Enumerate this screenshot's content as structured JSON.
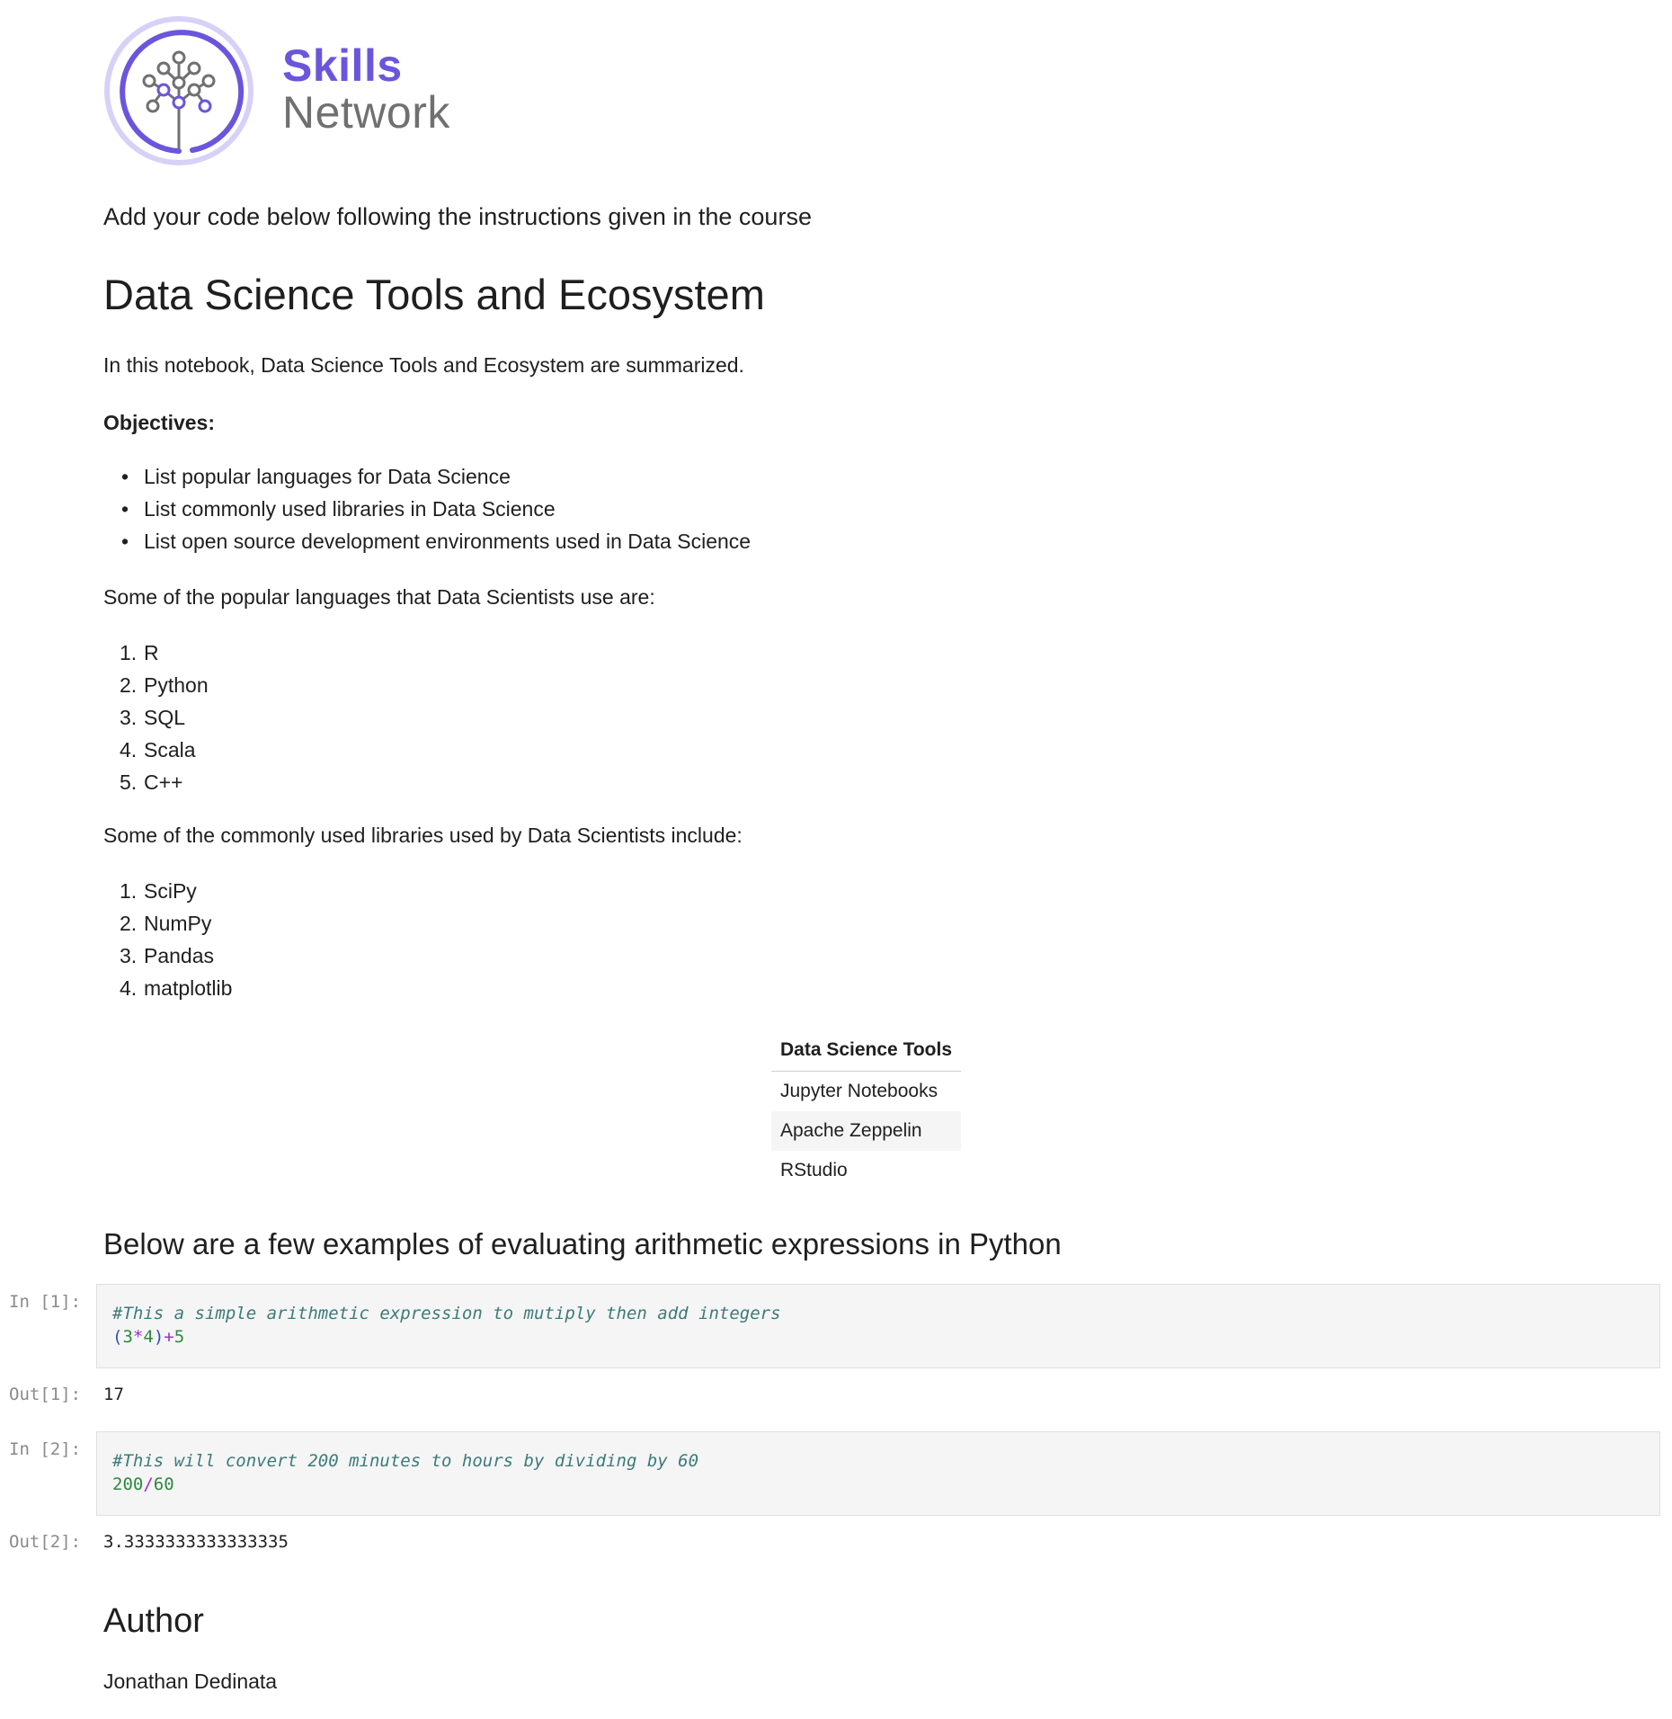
{
  "brand": {
    "line1": "Skills",
    "line2": "Network",
    "accent": "#6b55dc",
    "ring_color": "#d7d1f7"
  },
  "intro": "Add your code below following the instructions given in the course",
  "title": "Data Science Tools and Ecosystem",
  "summary": "In this notebook, Data Science Tools and Ecosystem are summarized.",
  "objectives_label": "Objectives:",
  "objectives": [
    "List popular languages for Data Science",
    "List commonly used libraries in Data Science",
    "List open source development environments used in Data Science"
  ],
  "languages_intro": "Some of the popular languages that Data Scientists use are:",
  "languages": [
    "R",
    "Python",
    "SQL",
    "Scala",
    "C++"
  ],
  "libraries_intro": "Some of the commonly used libraries used by Data Scientists include:",
  "libraries": [
    "SciPy",
    "NumPy",
    "Pandas",
    "matplotlib"
  ],
  "tools_table": {
    "header": "Data Science Tools",
    "rows": [
      "Jupyter Notebooks",
      "Apache Zeppelin",
      "RStudio"
    ]
  },
  "arith_heading": "Below are a few examples of evaluating arithmetic expressions in Python",
  "cells": [
    {
      "in_prompt": "In [1]:",
      "comment": "#This a simple arithmetic expression to mutiply then add integers",
      "code_tokens": [
        "(",
        "3",
        "*",
        "4",
        ")",
        "+",
        "5"
      ],
      "out_prompt": "Out[1]:",
      "output": "17"
    },
    {
      "in_prompt": "In [2]:",
      "comment": "#This will convert 200 minutes to hours by dividing by 60",
      "code_tokens": [
        "200",
        "/",
        "60"
      ],
      "out_prompt": "Out[2]:",
      "output": "3.3333333333333335"
    }
  ],
  "author_heading": "Author",
  "author_name": "Jonathan Dedinata"
}
